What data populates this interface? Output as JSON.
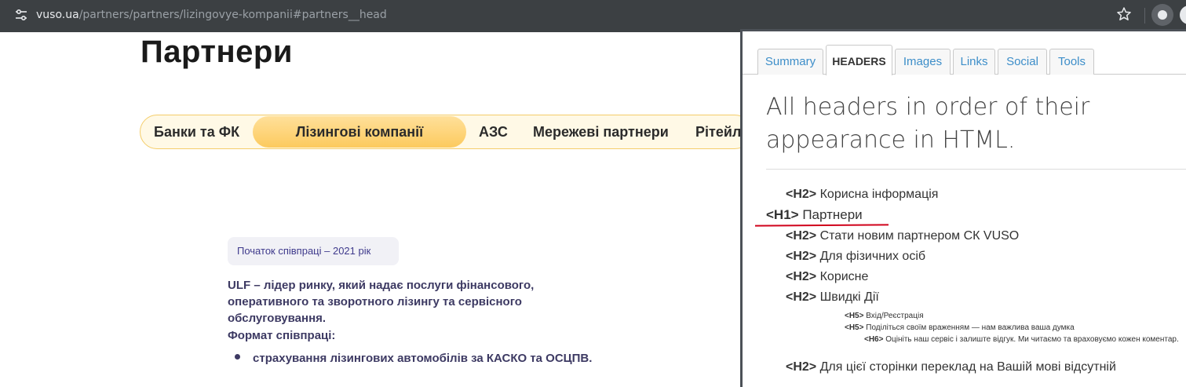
{
  "browser": {
    "url_host": "vuso.ua",
    "url_path": "/partners/partners/lizingovye-kompanii#partners__head"
  },
  "page": {
    "title": "Партнери",
    "tabs": [
      {
        "label": "Банки та ФК",
        "active": false
      },
      {
        "label": "Лізингові компанії",
        "active": true
      },
      {
        "label": "АЗС",
        "active": false
      },
      {
        "label": "Мережеві партнери",
        "active": false
      },
      {
        "label": "Рітейл",
        "active": false
      }
    ],
    "since_badge": "Початок співпраці – 2021 рік",
    "description": "ULF – лідер ринку, який надає послуги фінансового, оперативного та зворотного лізингу та сервісного обслуговування.",
    "format_label": "Формат співпраці:",
    "bullets": [
      "страхування лізингових автомобілів за КАСКО та ОСЦПВ."
    ]
  },
  "panel": {
    "tabs": [
      "Summary",
      "HEADERS",
      "Images",
      "Links",
      "Social",
      "Tools"
    ],
    "active_tab": "HEADERS",
    "heading": "All headers in order of their appearance in HTML.",
    "headers": [
      {
        "tag": "<H2>",
        "text": "Корисна інформація"
      },
      {
        "tag": "<H1>",
        "text": "Партнери"
      },
      {
        "tag": "<H2>",
        "text": "Стати новим партнером СК VUSO"
      },
      {
        "tag": "<H2>",
        "text": "Для фізичних осіб"
      },
      {
        "tag": "<H2>",
        "text": "Корисне"
      },
      {
        "tag": "<H2>",
        "text": "Швидкі Дії"
      },
      {
        "tag": "<H5>",
        "text": "Вхід/Реєстрація"
      },
      {
        "tag": "<H5>",
        "text": "Поділіться своїм враженням — нам важлива ваша думка"
      },
      {
        "tag": "<H6>",
        "text": "Оцініть наш сервіс і залиште відгук. Ми читаємо та враховуємо кожен коментар."
      },
      {
        "tag": "<H2>",
        "text": "Для цієї сторінки переклад на Вашій мові відсутній"
      }
    ]
  },
  "colors": {
    "accent_yellow": "#fcca5e",
    "link_blue": "#3d8ec9",
    "annotation_red": "#d0021b",
    "text_navy": "#3d3a63"
  }
}
